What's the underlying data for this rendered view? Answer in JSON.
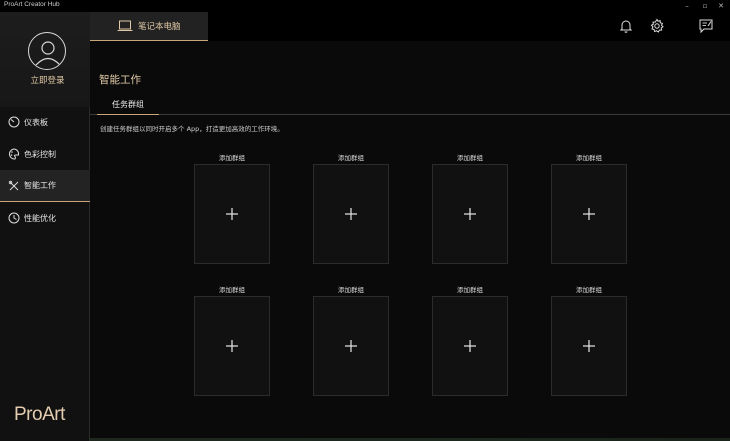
{
  "window": {
    "title": "ProArt Creator Hub",
    "controls": [
      "–",
      "▫",
      "✕"
    ]
  },
  "sidebar": {
    "login_label": "立即登录",
    "items": [
      {
        "label": "仪表板",
        "icon": "dashboard-icon",
        "active": false
      },
      {
        "label": "色彩控制",
        "icon": "palette-icon",
        "active": false
      },
      {
        "label": "智能工作",
        "icon": "tools-icon",
        "active": true
      },
      {
        "label": "性能优化",
        "icon": "performance-icon",
        "active": false
      }
    ],
    "logo": "ProArt"
  },
  "topbar": {
    "device_label": "笔记本电脑",
    "icons": [
      "bell-icon",
      "gear-icon",
      "feedback-icon"
    ]
  },
  "main": {
    "title": "智能工作",
    "tab": "任务群组",
    "description": "创建任务群组以同时开启多个 App，打造更加高效的工作环境。",
    "cards": [
      {
        "label": "添加群组"
      },
      {
        "label": "添加群组"
      },
      {
        "label": "添加群组"
      },
      {
        "label": "添加群组"
      },
      {
        "label": "添加群组"
      },
      {
        "label": "添加群组"
      },
      {
        "label": "添加群组"
      },
      {
        "label": "添加群组"
      }
    ]
  },
  "colors": {
    "accent": "#c8a57a",
    "accent_text": "#e0c9a6",
    "background": "#0a0a0a",
    "sidebar": "#111111"
  }
}
